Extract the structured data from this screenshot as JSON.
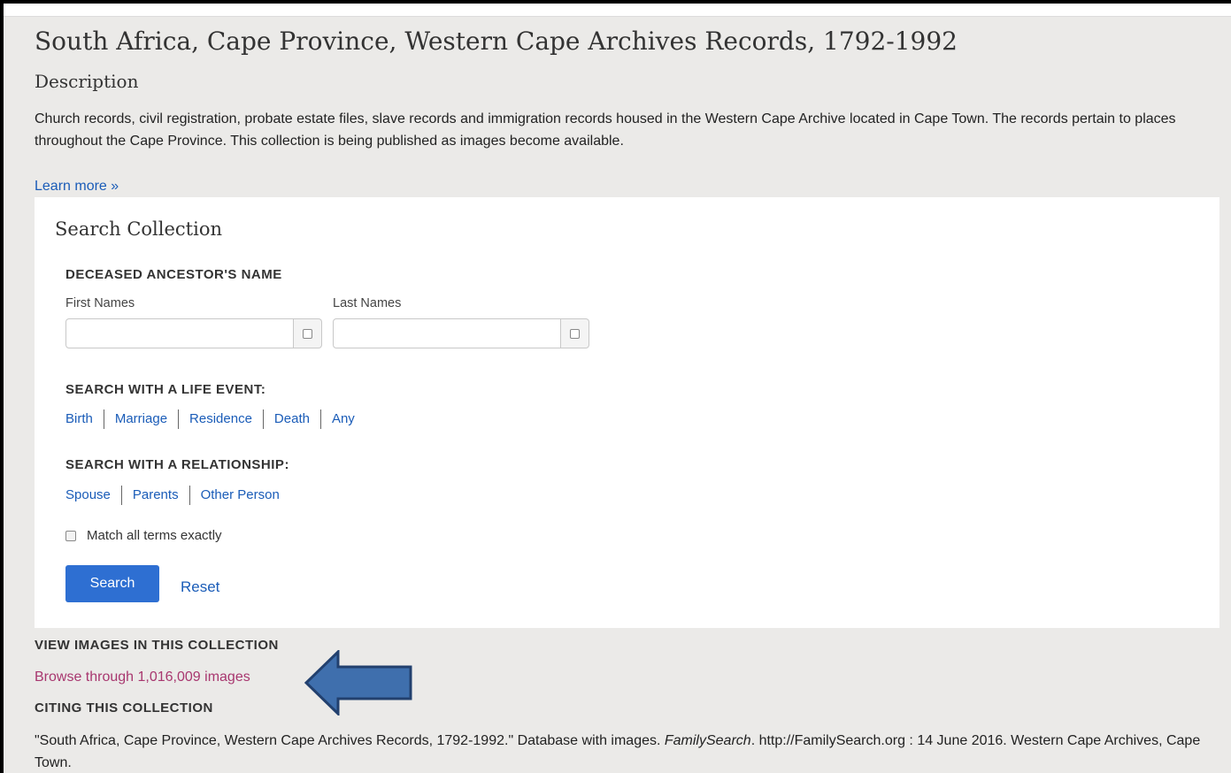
{
  "page": {
    "title": "South Africa, Cape Province, Western Cape Archives Records, 1792-1992",
    "description_heading": "Description",
    "description_text": "Church records, civil registration, probate estate files, slave records and immigration records housed in the Western Cape Archive located in Cape Town. The records pertain to places throughout the Cape Province. This collection is being published as images become available.",
    "learn_more": "Learn more »"
  },
  "search": {
    "title": "Search Collection",
    "deceased_label": "DECEASED ANCESTOR'S NAME",
    "first_names_label": "First Names",
    "last_names_label": "Last Names",
    "first_names_value": "",
    "last_names_value": "",
    "life_event_label": "SEARCH WITH A LIFE EVENT:",
    "life_events": [
      "Birth",
      "Marriage",
      "Residence",
      "Death",
      "Any"
    ],
    "relationship_label": "SEARCH WITH A RELATIONSHIP:",
    "relationships": [
      "Spouse",
      "Parents",
      "Other Person"
    ],
    "match_exact_label": "Match all terms exactly",
    "match_exact_checked": false,
    "search_button": "Search",
    "reset_link": "Reset"
  },
  "images": {
    "heading": "VIEW IMAGES IN THIS COLLECTION",
    "browse_link": "Browse through 1,016,009 images"
  },
  "citing": {
    "heading": "CITING THIS COLLECTION",
    "text_part1": "\"South Africa, Cape Province, Western Cape Archives Records, 1792-1992.\" Database with images. ",
    "text_italic": "FamilySearch",
    "text_part2": ". http://FamilySearch.org : 14 June 2016. Western Cape Archives, Cape Town."
  },
  "annotation": {
    "arrow_color": "#3f6fad",
    "arrow_outline": "#22406e",
    "arrow_direction": "left",
    "arrow_points_to": "images.browse_link"
  }
}
